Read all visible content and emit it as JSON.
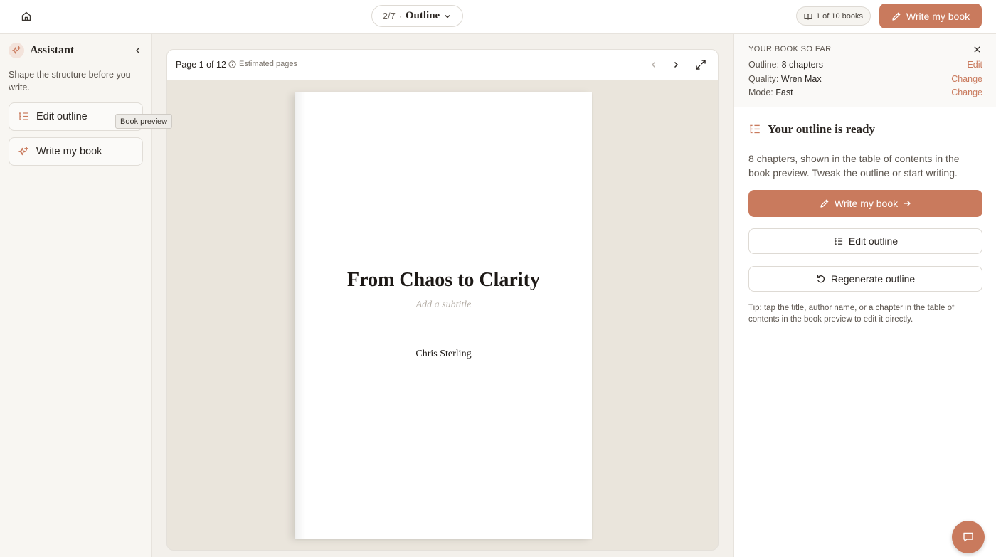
{
  "header": {
    "step": "2/7",
    "separator": "·",
    "step_name": "Outline",
    "books_count": "1 of 10 books",
    "write_button": "Write my book"
  },
  "sidebar": {
    "title": "Assistant",
    "description": "Shape the structure before you write.",
    "items": [
      {
        "label": "Edit outline",
        "icon": "outline-list-icon"
      },
      {
        "label": "Write my book",
        "icon": "sparkle-icon"
      }
    ],
    "tooltip": "Book preview"
  },
  "preview": {
    "page_label": "Page 1 of 12",
    "estimated_label": "Estimated pages",
    "book": {
      "title": "From Chaos to Clarity",
      "subtitle_placeholder": "Add a subtitle",
      "author": "Chris Sterling"
    }
  },
  "summary": {
    "heading": "YOUR BOOK SO FAR",
    "rows": [
      {
        "key": "Outline:",
        "value": "8 chapters",
        "action": "Edit"
      },
      {
        "key": "Quality:",
        "value": "Wren Max",
        "action": "Change"
      },
      {
        "key": "Mode:",
        "value": "Fast",
        "action": "Change"
      }
    ]
  },
  "ready": {
    "title": "Your outline is ready",
    "description": "8 chapters, shown in the table of contents in the book preview. Tweak the outline or start writing.",
    "write_button": "Write my book",
    "edit_button": "Edit outline",
    "regenerate_button": "Regenerate outline",
    "tip": "Tip: tap the title, author name, or a chapter in the table of contents in the book preview to edit it directly."
  },
  "colors": {
    "accent": "#c97a5d",
    "background": "#f7f5f1",
    "text": "#2b2622"
  }
}
